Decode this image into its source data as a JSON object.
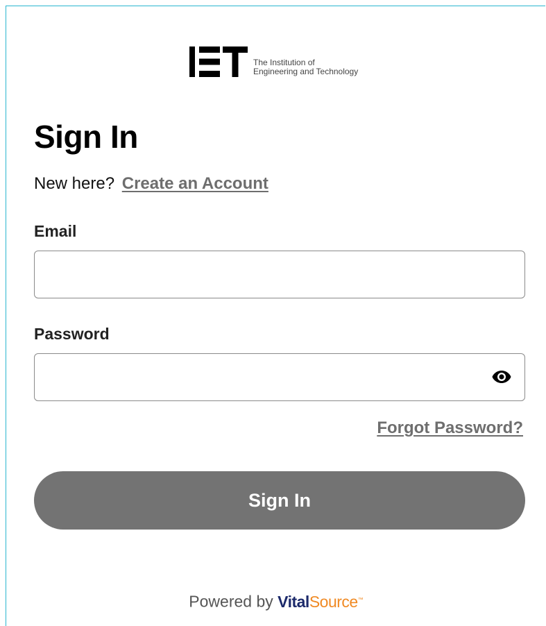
{
  "brand": {
    "logo_mark": "IET",
    "logo_line1": "The Institution of",
    "logo_line2": "Engineering and Technology"
  },
  "page": {
    "title": "Sign In",
    "new_here_text": "New here?",
    "create_account_label": "Create an Account"
  },
  "form": {
    "email_label": "Email",
    "email_value": "",
    "email_placeholder": "",
    "password_label": "Password",
    "password_value": "",
    "password_placeholder": "",
    "show_password_icon": "eye-icon",
    "forgot_password_label": "Forgot Password?",
    "submit_label": "Sign In"
  },
  "footer": {
    "powered_by_text": "Powered by",
    "vendor_part1": "Vital",
    "vendor_part2": "Source"
  },
  "colors": {
    "accent_border": "#29b6d0",
    "button_bg": "#737373",
    "link_color": "#6e6e6e",
    "vitalsource_navy": "#1c2a6b",
    "vitalsource_orange": "#f08a24"
  }
}
